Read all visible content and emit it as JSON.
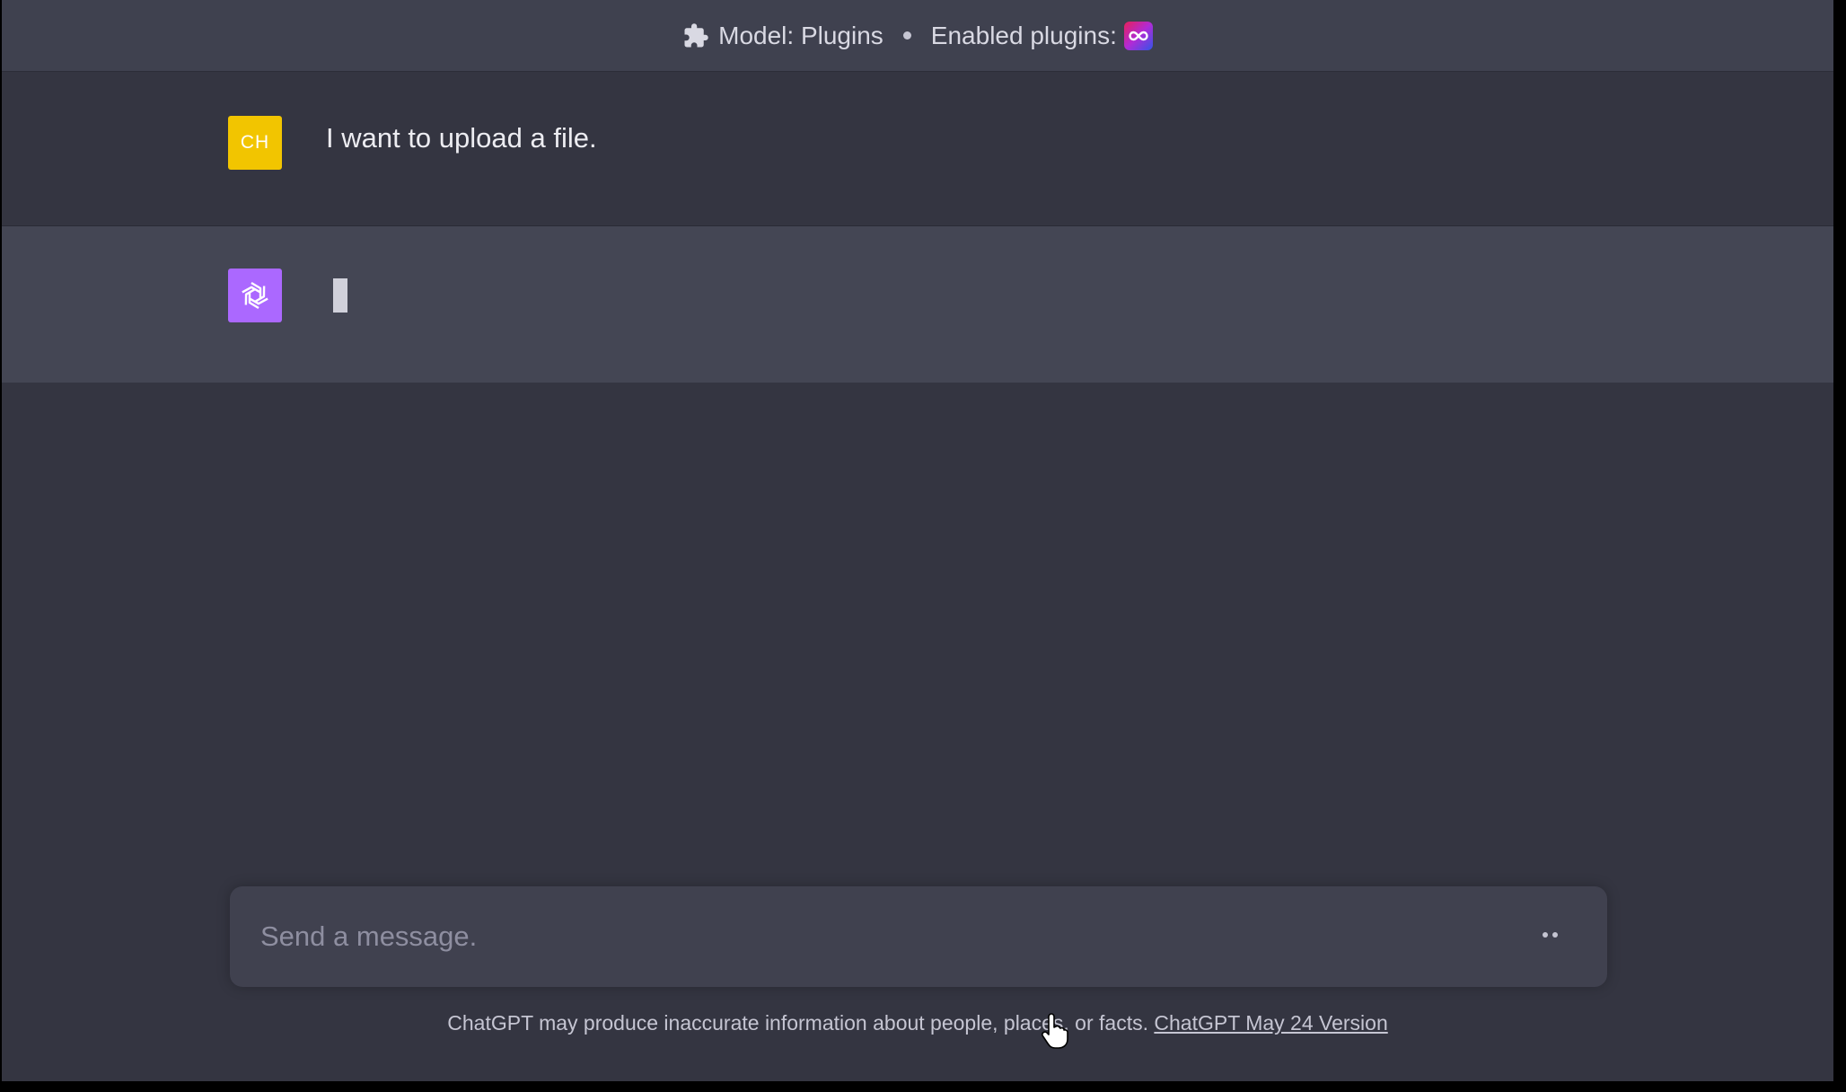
{
  "header": {
    "model_label": "Model: Plugins",
    "separator": "•",
    "enabled_label": "Enabled plugins:",
    "puzzle_icon": "puzzle-icon",
    "plugin_icon": "infinity-plugin-icon",
    "plugin_colors": [
      "#e8205a",
      "#b02bd6",
      "#3354e8"
    ]
  },
  "conversation": {
    "user": {
      "avatar_initials": "CH",
      "avatar_color": "#f2c500",
      "text": "I want to upload a file."
    },
    "assistant": {
      "avatar_icon": "openai-logo-icon",
      "avatar_color": "#ab68ff",
      "state": "streaming-cursor"
    }
  },
  "composer": {
    "placeholder": "Send a message.",
    "value": "",
    "status_icon": "typing-dots-icon"
  },
  "footer": {
    "disclaimer": "ChatGPT may produce inaccurate information about people, places, or facts.",
    "version_link": "ChatGPT May 24 Version"
  },
  "colors": {
    "background": "#343541",
    "header_bg": "#3f414f",
    "assistant_bg": "#444654",
    "composer_bg": "#40414f"
  }
}
